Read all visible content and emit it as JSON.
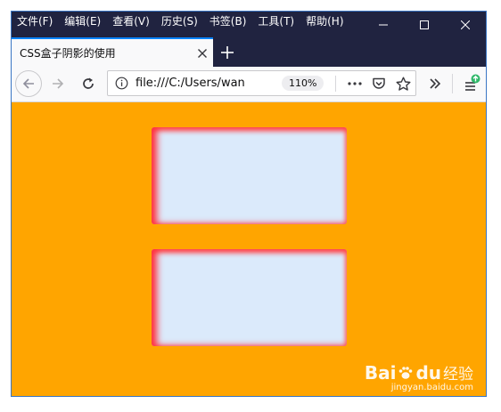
{
  "menubar": {
    "items": [
      {
        "label": "文件(F)"
      },
      {
        "label": "编辑(E)"
      },
      {
        "label": "查看(V)"
      },
      {
        "label": "历史(S)"
      },
      {
        "label": "书签(B)"
      },
      {
        "label": "工具(T)"
      },
      {
        "label": "帮助(H)"
      }
    ]
  },
  "tab": {
    "title": "CSS盒子阴影的使用"
  },
  "toolbar": {
    "url": "file:///C:/Users/wan",
    "zoom": "110%"
  },
  "colors": {
    "titlebar": "#202340",
    "page_background": "#ffa500",
    "box_fill": "#dbeafb",
    "box_shadow": "#ff3340",
    "tab_accent": "#0a84ff"
  },
  "icons": [
    "minimize-icon",
    "maximize-icon",
    "close-icon",
    "tab-close-icon",
    "new-tab-icon",
    "back-arrow-icon",
    "forward-arrow-icon",
    "reload-icon",
    "info-icon",
    "more-dots-icon",
    "pocket-icon",
    "bookmark-star-icon",
    "chevrons-icon",
    "hamburger-menu-icon"
  ],
  "watermark": {
    "brand": "Bai",
    "brand_tail": "du",
    "suffix": "经验",
    "url": "jingyan.baidu.com"
  }
}
